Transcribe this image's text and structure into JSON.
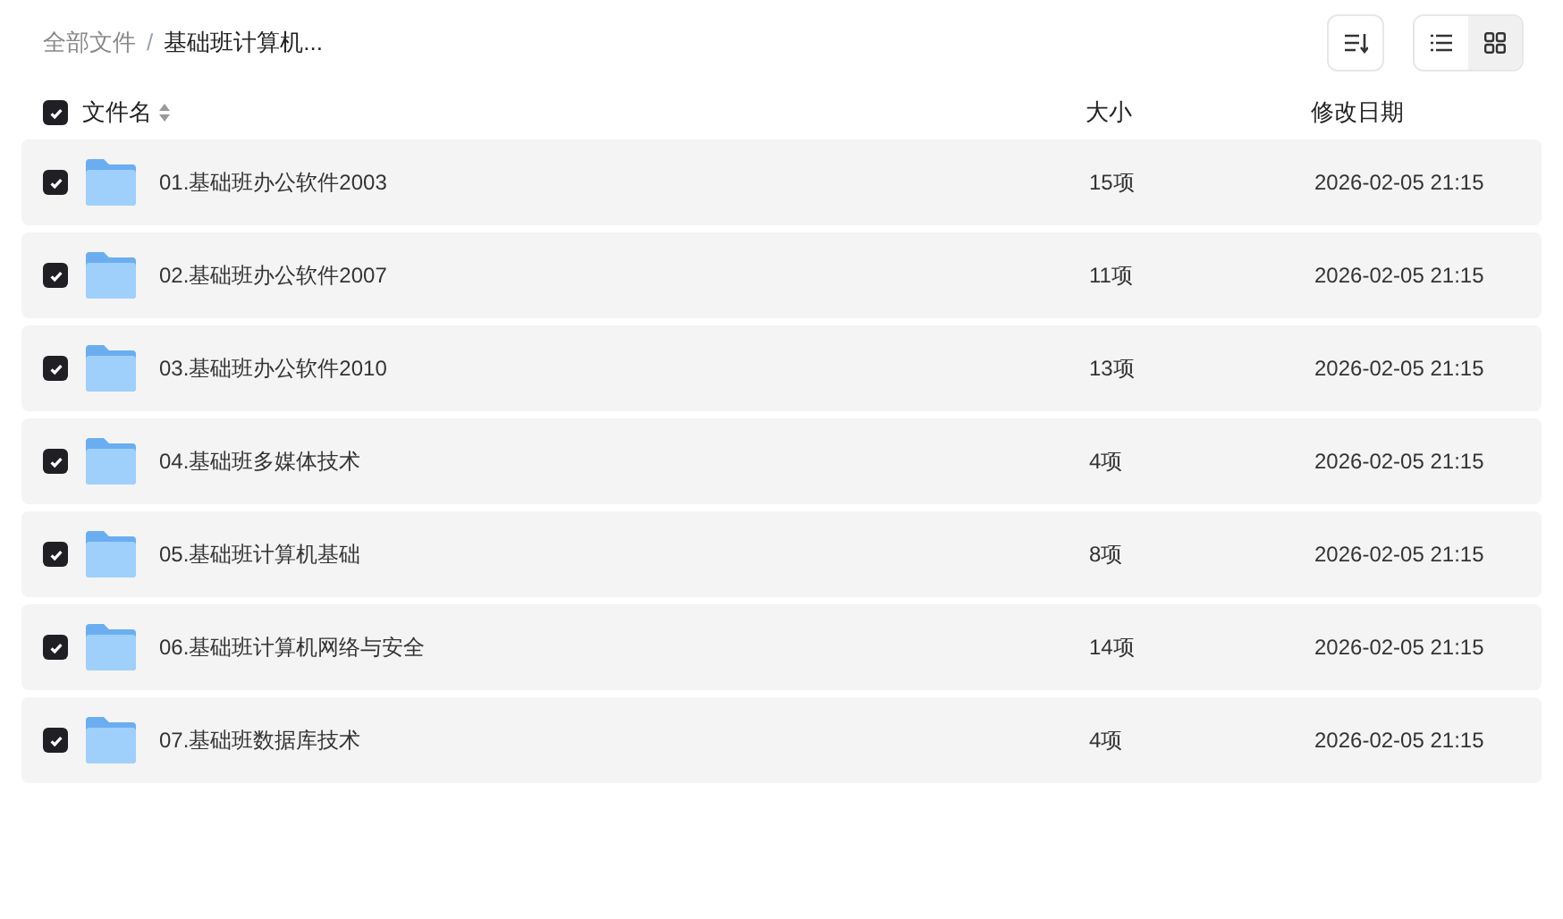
{
  "breadcrumb": [
    {
      "label": "全部文件",
      "current": false
    },
    {
      "label": "基础班计算机...",
      "current": true
    }
  ],
  "breadcrumb_separator": "/",
  "view_toggle": [
    {
      "kind": "list",
      "selected": false
    },
    {
      "kind": "grid",
      "selected": true
    }
  ],
  "header": {
    "select_all_checked": true,
    "columns": [
      "文件名",
      "大小",
      "修改日期"
    ]
  },
  "rows": [
    {
      "name": "01.基础班办公软件2003",
      "size": "15项",
      "modified": "2026-02-05 21:15",
      "checked": true
    },
    {
      "name": "02.基础班办公软件2007",
      "size": "11项",
      "modified": "2026-02-05 21:15",
      "checked": true
    },
    {
      "name": "03.基础班办公软件2010",
      "size": "13项",
      "modified": "2026-02-05 21:15",
      "checked": true
    },
    {
      "name": "04.基础班多媒体技术",
      "size": "4项",
      "modified": "2026-02-05 21:15",
      "checked": true
    },
    {
      "name": "05.基础班计算机基础",
      "size": "8项",
      "modified": "2026-02-05 21:15",
      "checked": true
    },
    {
      "name": "06.基础班计算机网络与安全",
      "size": "14项",
      "modified": "2026-02-05 21:15",
      "checked": true
    },
    {
      "name": "07.基础班数据库技术",
      "size": "4项",
      "modified": "2026-02-05 21:15",
      "checked": true
    }
  ]
}
